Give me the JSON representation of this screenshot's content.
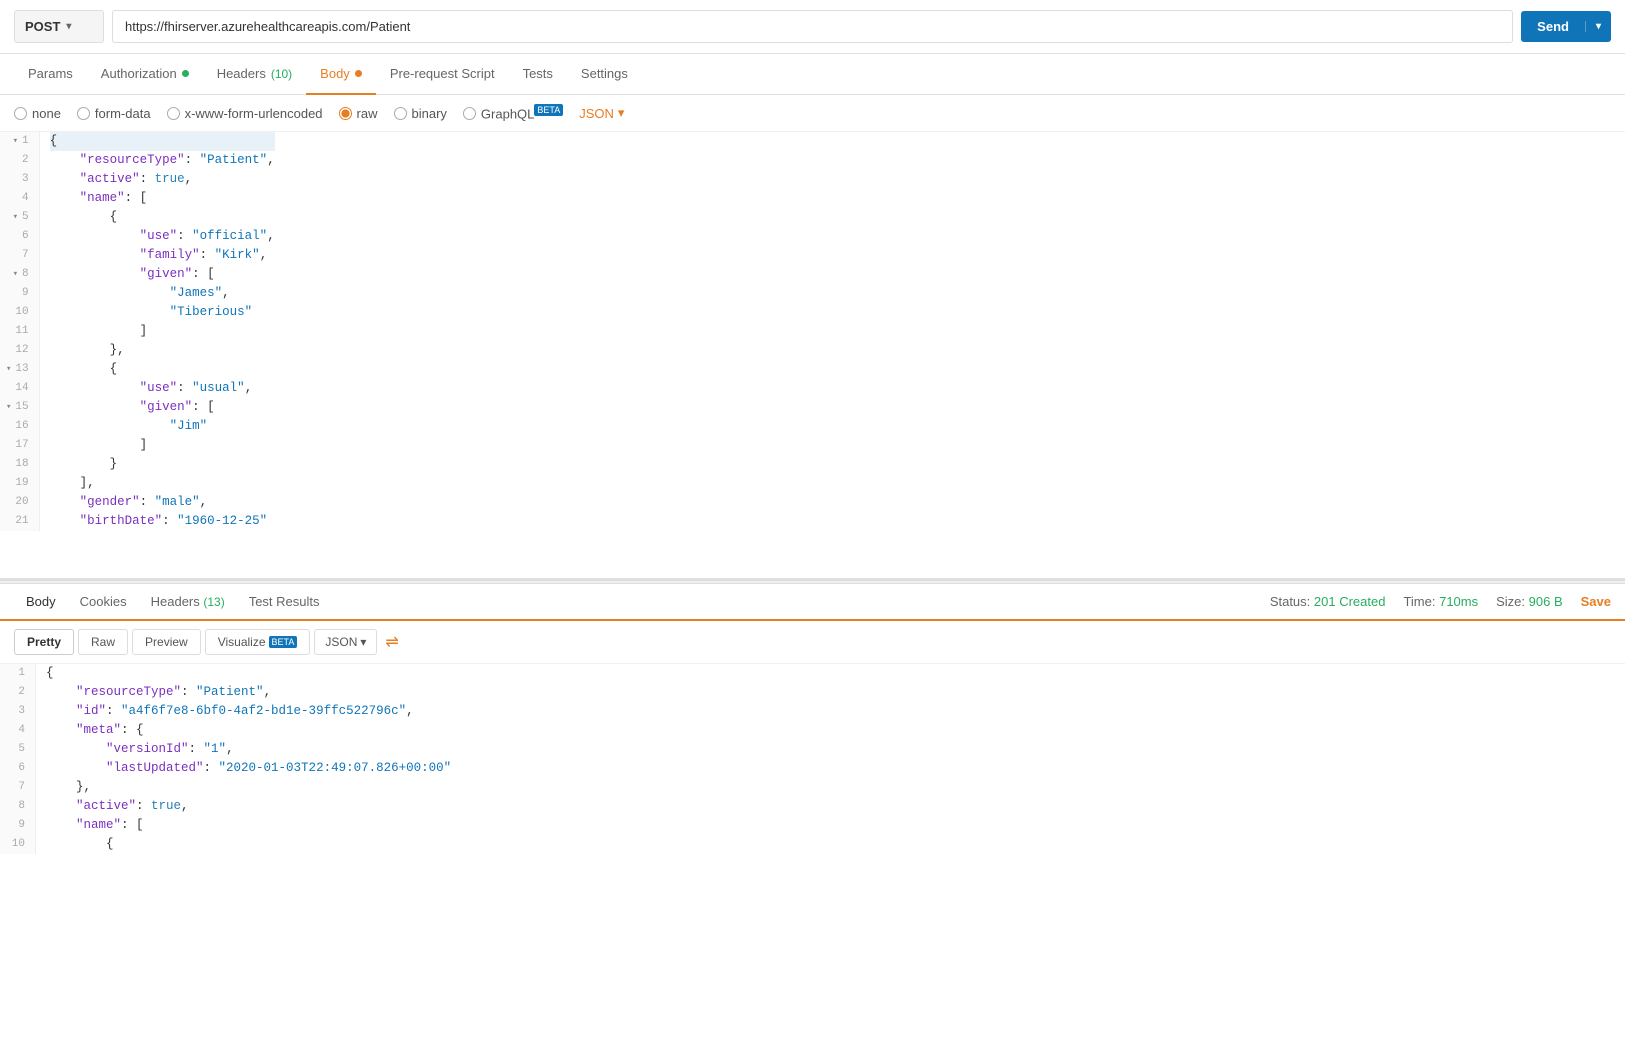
{
  "urlBar": {
    "method": "POST",
    "methodArrow": "▾",
    "url": "https://fhirserver.azurehealthcareapis.com/Patient",
    "sendLabel": "Send",
    "sendArrow": "▾"
  },
  "reqTabs": [
    {
      "id": "params",
      "label": "Params",
      "active": false,
      "dot": null
    },
    {
      "id": "authorization",
      "label": "Authorization",
      "active": false,
      "dot": "green"
    },
    {
      "id": "headers",
      "label": "Headers",
      "active": false,
      "badge": "(10)",
      "dot": null
    },
    {
      "id": "body",
      "label": "Body",
      "active": true,
      "dot": "orange"
    },
    {
      "id": "prerequest",
      "label": "Pre-request Script",
      "active": false,
      "dot": null
    },
    {
      "id": "tests",
      "label": "Tests",
      "active": false,
      "dot": null
    },
    {
      "id": "settings",
      "label": "Settings",
      "active": false,
      "dot": null
    }
  ],
  "formatOptions": [
    {
      "id": "none",
      "label": "none",
      "selected": false
    },
    {
      "id": "form-data",
      "label": "form-data",
      "selected": false
    },
    {
      "id": "x-www-form-urlencoded",
      "label": "x-www-form-urlencoded",
      "selected": false
    },
    {
      "id": "raw",
      "label": "raw",
      "selected": true
    },
    {
      "id": "binary",
      "label": "binary",
      "selected": false
    },
    {
      "id": "graphql",
      "label": "GraphQL",
      "selected": false,
      "beta": "BETA"
    }
  ],
  "jsonDropdown": "JSON",
  "requestCode": [
    {
      "num": 1,
      "fold": false,
      "highlight": true,
      "content": "{",
      "parts": [
        {
          "t": "punc",
          "v": "{"
        }
      ]
    },
    {
      "num": 2,
      "fold": false,
      "highlight": false,
      "content": "    \"resourceType\": \"Patient\",",
      "parts": [
        {
          "t": "key",
          "v": "    \"resourceType\""
        },
        {
          "t": "punc",
          "v": ": "
        },
        {
          "t": "str",
          "v": "\"Patient\""
        },
        {
          "t": "punc",
          "v": ","
        }
      ]
    },
    {
      "num": 3,
      "fold": false,
      "highlight": false,
      "content": "    \"active\": true,",
      "parts": [
        {
          "t": "key",
          "v": "    \"active\""
        },
        {
          "t": "punc",
          "v": ": "
        },
        {
          "t": "bool",
          "v": "true"
        },
        {
          "t": "punc",
          "v": ","
        }
      ]
    },
    {
      "num": 4,
      "fold": false,
      "highlight": false,
      "content": "    \"name\": [",
      "parts": [
        {
          "t": "key",
          "v": "    \"name\""
        },
        {
          "t": "punc",
          "v": ": ["
        }
      ]
    },
    {
      "num": 5,
      "fold": true,
      "highlight": false,
      "content": "        {",
      "parts": [
        {
          "t": "punc",
          "v": "        {"
        }
      ]
    },
    {
      "num": 6,
      "fold": false,
      "highlight": false,
      "content": "            \"use\": \"official\",",
      "parts": [
        {
          "t": "key",
          "v": "            \"use\""
        },
        {
          "t": "punc",
          "v": ": "
        },
        {
          "t": "str",
          "v": "\"official\""
        },
        {
          "t": "punc",
          "v": ","
        }
      ]
    },
    {
      "num": 7,
      "fold": false,
      "highlight": false,
      "content": "            \"family\": \"Kirk\",",
      "parts": [
        {
          "t": "key",
          "v": "            \"family\""
        },
        {
          "t": "punc",
          "v": ": "
        },
        {
          "t": "str",
          "v": "\"Kirk\""
        },
        {
          "t": "punc",
          "v": ","
        }
      ]
    },
    {
      "num": 8,
      "fold": true,
      "highlight": false,
      "content": "            \"given\": [",
      "parts": [
        {
          "t": "key",
          "v": "            \"given\""
        },
        {
          "t": "punc",
          "v": ": ["
        }
      ]
    },
    {
      "num": 9,
      "fold": false,
      "highlight": false,
      "content": "                \"James\",",
      "parts": [
        {
          "t": "str",
          "v": "                \"James\""
        },
        {
          "t": "punc",
          "v": ","
        }
      ]
    },
    {
      "num": 10,
      "fold": false,
      "highlight": false,
      "content": "                \"Tiberious\"",
      "parts": [
        {
          "t": "str",
          "v": "                \"Tiberious\""
        }
      ]
    },
    {
      "num": 11,
      "fold": false,
      "highlight": false,
      "content": "            ]",
      "parts": [
        {
          "t": "punc",
          "v": "            ]"
        }
      ]
    },
    {
      "num": 12,
      "fold": false,
      "highlight": false,
      "content": "        },",
      "parts": [
        {
          "t": "punc",
          "v": "        },"
        }
      ]
    },
    {
      "num": 13,
      "fold": true,
      "highlight": false,
      "content": "        {",
      "parts": [
        {
          "t": "punc",
          "v": "        {"
        }
      ]
    },
    {
      "num": 14,
      "fold": false,
      "highlight": false,
      "content": "            \"use\": \"usual\",",
      "parts": [
        {
          "t": "key",
          "v": "            \"use\""
        },
        {
          "t": "punc",
          "v": ": "
        },
        {
          "t": "str",
          "v": "\"usual\""
        },
        {
          "t": "punc",
          "v": ","
        }
      ]
    },
    {
      "num": 15,
      "fold": true,
      "highlight": false,
      "content": "            \"given\": [",
      "parts": [
        {
          "t": "key",
          "v": "            \"given\""
        },
        {
          "t": "punc",
          "v": ": ["
        }
      ]
    },
    {
      "num": 16,
      "fold": false,
      "highlight": false,
      "content": "                \"Jim\"",
      "parts": [
        {
          "t": "str",
          "v": "                \"Jim\""
        }
      ]
    },
    {
      "num": 17,
      "fold": false,
      "highlight": false,
      "content": "            ]",
      "parts": [
        {
          "t": "punc",
          "v": "            ]"
        }
      ]
    },
    {
      "num": 18,
      "fold": false,
      "highlight": false,
      "content": "        }",
      "parts": [
        {
          "t": "punc",
          "v": "        }"
        }
      ]
    },
    {
      "num": 19,
      "fold": false,
      "highlight": false,
      "content": "    ],",
      "parts": [
        {
          "t": "punc",
          "v": "    ],"
        }
      ]
    },
    {
      "num": 20,
      "fold": false,
      "highlight": false,
      "content": "    \"gender\": \"male\",",
      "parts": [
        {
          "t": "key",
          "v": "    \"gender\""
        },
        {
          "t": "punc",
          "v": ": "
        },
        {
          "t": "str",
          "v": "\"male\""
        },
        {
          "t": "punc",
          "v": ","
        }
      ]
    },
    {
      "num": 21,
      "fold": false,
      "highlight": false,
      "content": "    \"birthDate\": \"1960-12-25\"",
      "parts": [
        {
          "t": "key",
          "v": "    \"birthDate\""
        },
        {
          "t": "punc",
          "v": ": "
        },
        {
          "t": "str",
          "v": "\"1960-12-25\""
        }
      ]
    }
  ],
  "responseTabs": [
    {
      "id": "body",
      "label": "Body",
      "active": true
    },
    {
      "id": "cookies",
      "label": "Cookies",
      "active": false
    },
    {
      "id": "headers",
      "label": "Headers",
      "badge": "(13)",
      "active": false
    },
    {
      "id": "testresults",
      "label": "Test Results",
      "active": false
    }
  ],
  "responseStatus": {
    "statusLabel": "Status:",
    "statusValue": "201 Created",
    "timeLabel": "Time:",
    "timeValue": "710ms",
    "sizeLabel": "Size:",
    "sizeValue": "906 B",
    "saveLabel": "Save"
  },
  "responseFmtButtons": [
    {
      "id": "pretty",
      "label": "Pretty",
      "active": true
    },
    {
      "id": "raw",
      "label": "Raw",
      "active": false
    },
    {
      "id": "preview",
      "label": "Preview",
      "active": false
    },
    {
      "id": "visualize",
      "label": "Visualize",
      "active": false,
      "beta": "BETA"
    }
  ],
  "responseJsonDropdown": "JSON",
  "responseCode": [
    {
      "num": 1,
      "parts": [
        {
          "t": "punc",
          "v": "{"
        }
      ]
    },
    {
      "num": 2,
      "parts": [
        {
          "t": "key",
          "v": "    \"resourceType\""
        },
        {
          "t": "punc",
          "v": ": "
        },
        {
          "t": "str",
          "v": "\"Patient\""
        },
        {
          "t": "punc",
          "v": ","
        }
      ]
    },
    {
      "num": 3,
      "parts": [
        {
          "t": "key",
          "v": "    \"id\""
        },
        {
          "t": "punc",
          "v": ": "
        },
        {
          "t": "str",
          "v": "\"a4f6f7e8-6bf0-4af2-bd1e-39ffc522796c\""
        },
        {
          "t": "punc",
          "v": ","
        }
      ]
    },
    {
      "num": 4,
      "parts": [
        {
          "t": "key",
          "v": "    \"meta\""
        },
        {
          "t": "punc",
          "v": ": {"
        }
      ]
    },
    {
      "num": 5,
      "parts": [
        {
          "t": "key",
          "v": "        \"versionId\""
        },
        {
          "t": "punc",
          "v": ": "
        },
        {
          "t": "str",
          "v": "\"1\""
        },
        {
          "t": "punc",
          "v": ","
        }
      ]
    },
    {
      "num": 6,
      "parts": [
        {
          "t": "key",
          "v": "        \"lastUpdated\""
        },
        {
          "t": "punc",
          "v": ": "
        },
        {
          "t": "str",
          "v": "\"2020-01-03T22:49:07.826+00:00\""
        }
      ]
    },
    {
      "num": 7,
      "parts": [
        {
          "t": "punc",
          "v": "    },"
        }
      ]
    },
    {
      "num": 8,
      "parts": [
        {
          "t": "key",
          "v": "    \"active\""
        },
        {
          "t": "punc",
          "v": ": "
        },
        {
          "t": "bool",
          "v": "true"
        },
        {
          "t": "punc",
          "v": ","
        }
      ]
    },
    {
      "num": 9,
      "parts": [
        {
          "t": "key",
          "v": "    \"name\""
        },
        {
          "t": "punc",
          "v": ": ["
        }
      ]
    },
    {
      "num": 10,
      "parts": [
        {
          "t": "punc",
          "v": "        {"
        }
      ]
    }
  ]
}
